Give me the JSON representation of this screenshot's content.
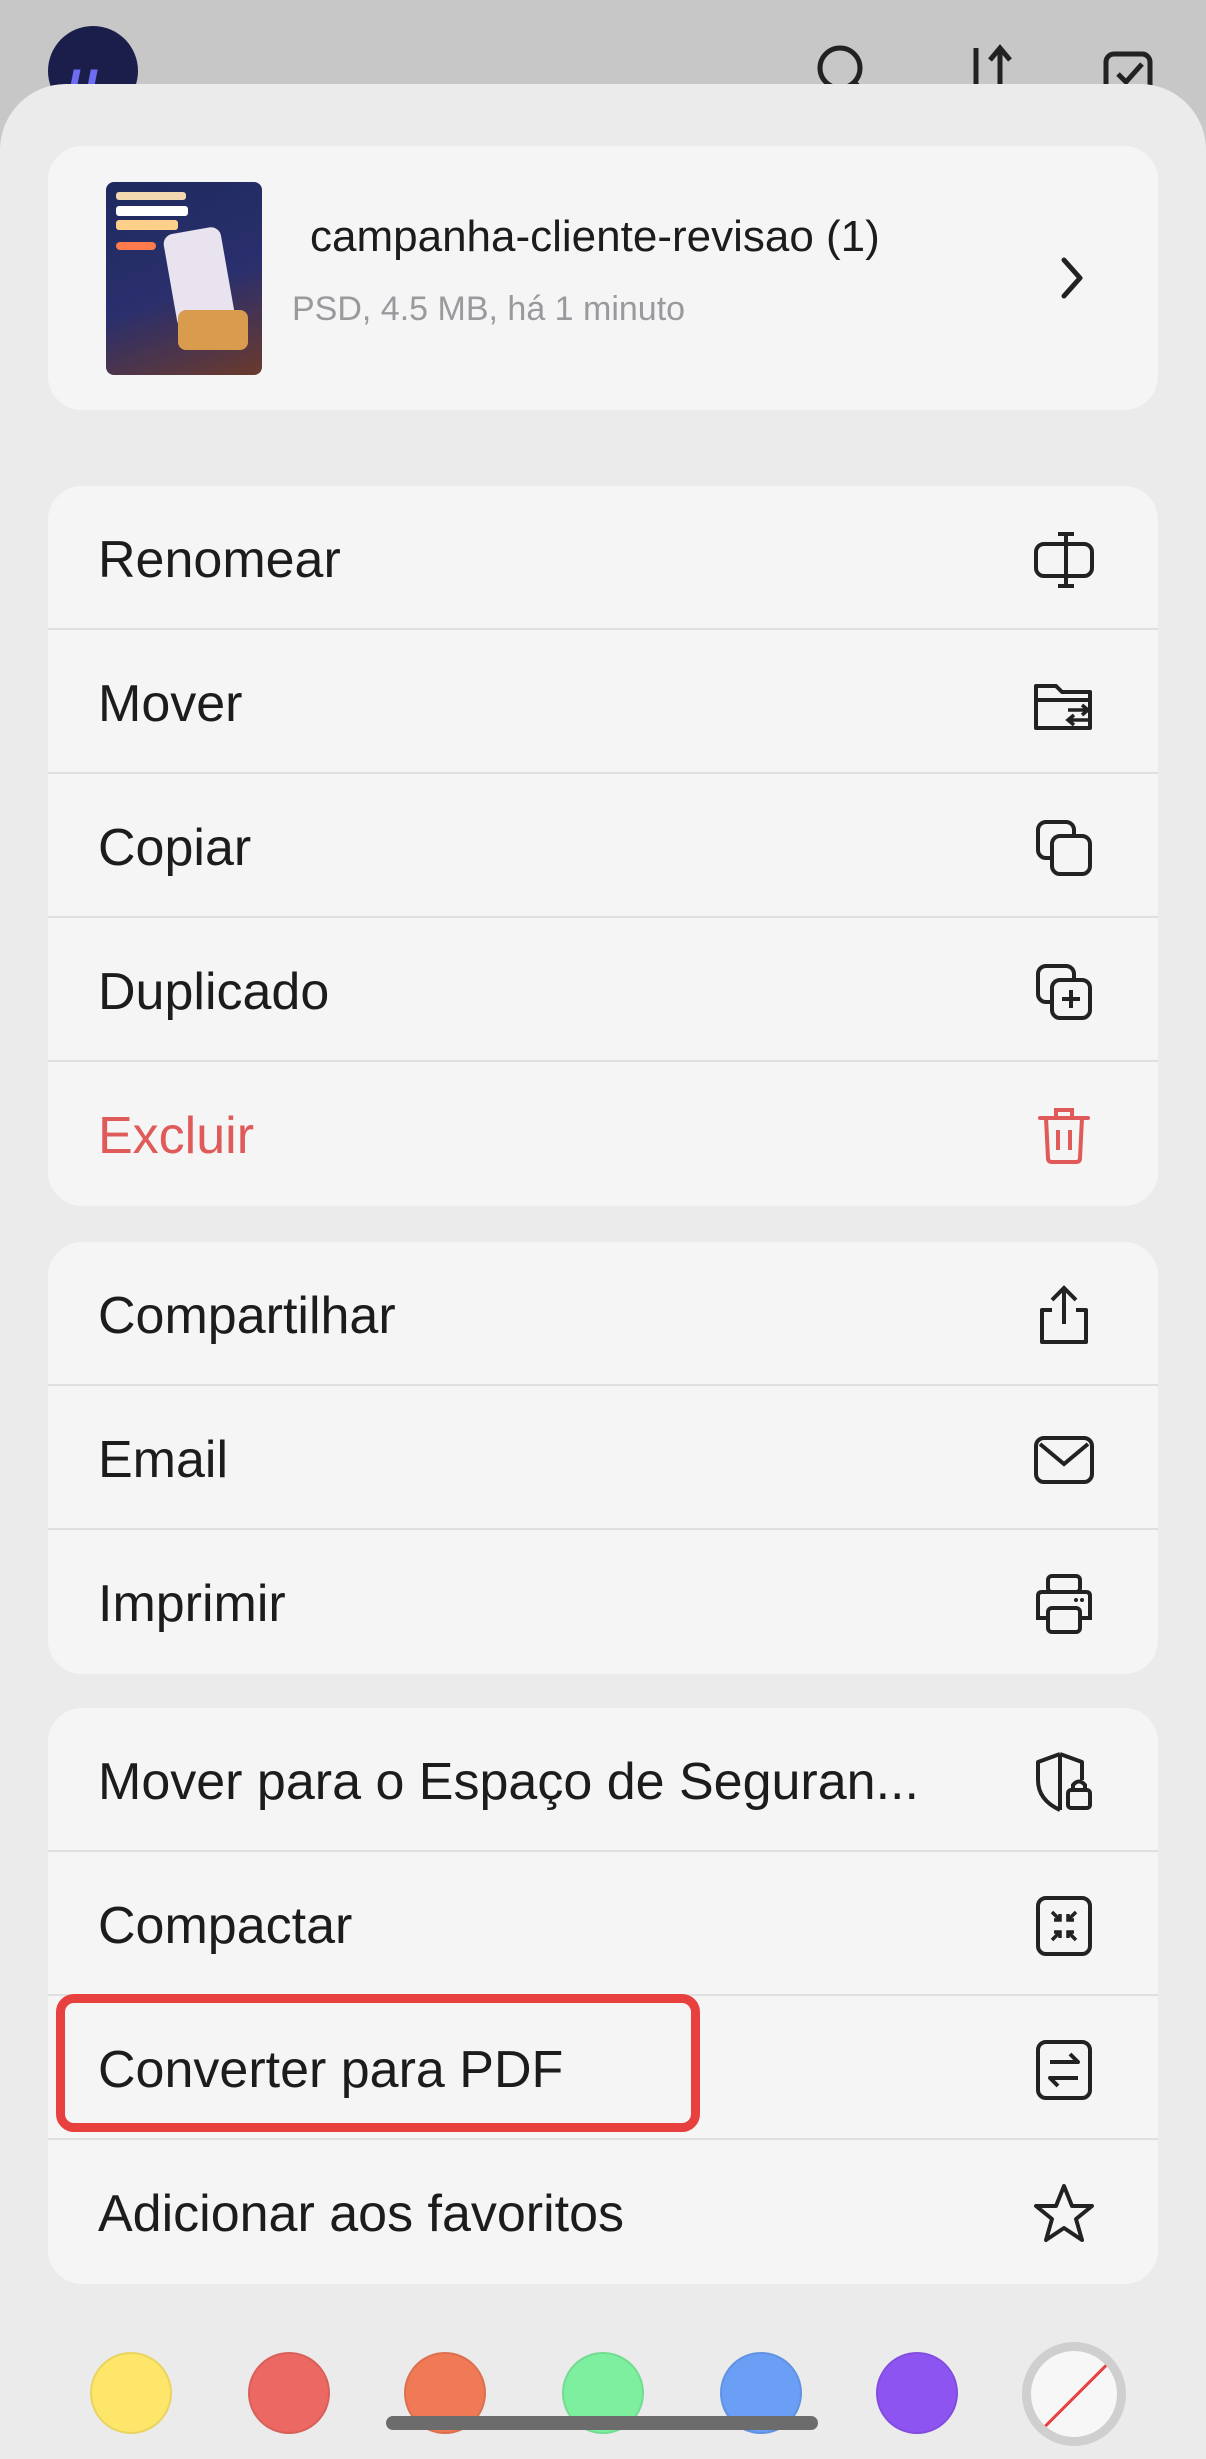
{
  "file": {
    "name": "campanha-cliente-revisao (1)",
    "meta": "PSD, 4.5 MB, há 1 minuto"
  },
  "groups": [
    {
      "items": [
        {
          "label": "Renomear",
          "icon": "rename-icon"
        },
        {
          "label": "Mover",
          "icon": "move-folder-icon"
        },
        {
          "label": "Copiar",
          "icon": "copy-icon"
        },
        {
          "label": "Duplicado",
          "icon": "duplicate-icon"
        },
        {
          "label": "Excluir",
          "icon": "trash-icon",
          "color": "#e05a5a"
        }
      ]
    },
    {
      "items": [
        {
          "label": "Compartilhar",
          "icon": "share-icon"
        },
        {
          "label": "Email",
          "icon": "mail-icon"
        },
        {
          "label": "Imprimir",
          "icon": "print-icon"
        }
      ]
    },
    {
      "items": [
        {
          "label": "Mover para o Espaço de Seguran...",
          "icon": "shield-lock-icon"
        },
        {
          "label": "Compactar",
          "icon": "compress-icon"
        },
        {
          "label": "Converter para PDF",
          "icon": "convert-icon",
          "highlighted": true
        },
        {
          "label": "Adicionar aos favoritos",
          "icon": "star-icon"
        }
      ]
    }
  ],
  "color_tags": [
    {
      "name": "yellow",
      "color": "#fde66a"
    },
    {
      "name": "red",
      "color": "#ec6862"
    },
    {
      "name": "orange",
      "color": "#ef7a55"
    },
    {
      "name": "green",
      "color": "#7eef9e"
    },
    {
      "name": "blue",
      "color": "#6a9ff5"
    },
    {
      "name": "purple",
      "color": "#8e54f2"
    },
    {
      "name": "none",
      "color": "#f7f7f7"
    }
  ],
  "accent_color": "#e8403f"
}
